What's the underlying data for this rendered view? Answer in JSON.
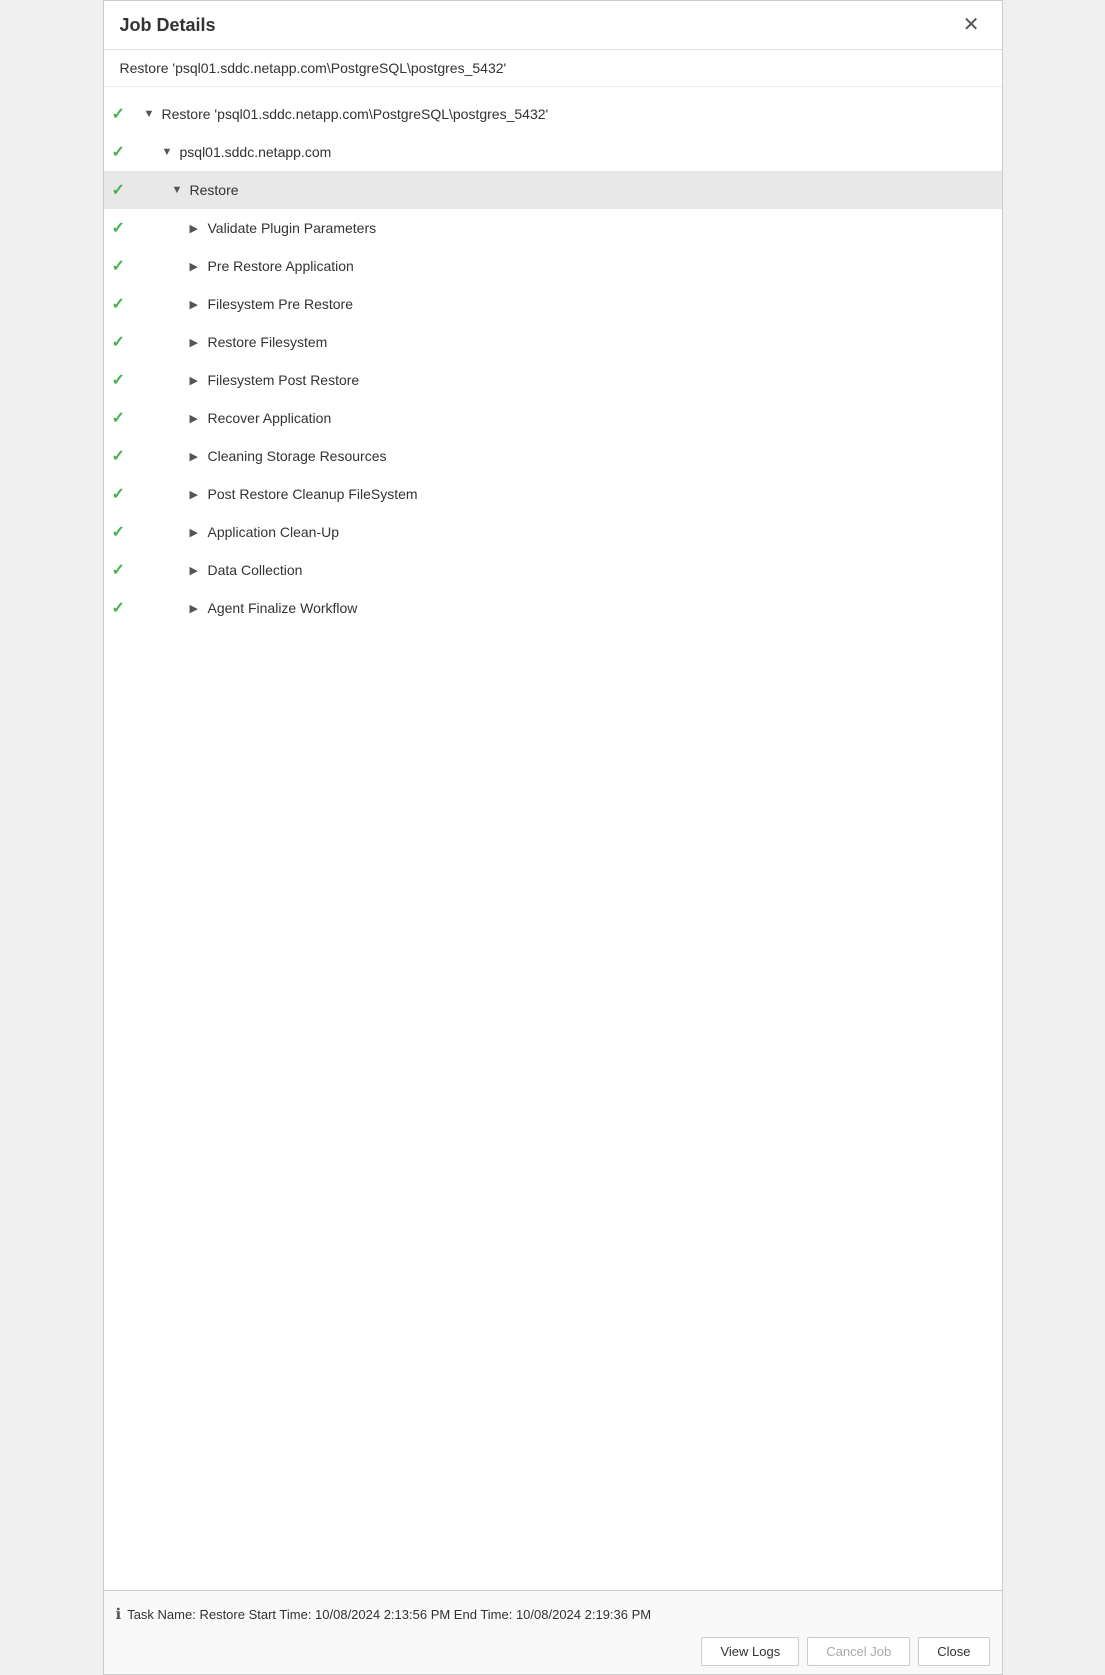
{
  "dialog": {
    "title": "Job Details",
    "close_label": "✕",
    "subtitle": "Restore 'psql01.sddc.netapp.com\\PostgreSQL\\postgres_5432'"
  },
  "tree": {
    "items": [
      {
        "id": "root",
        "indent": 1,
        "check": true,
        "expand": "▼",
        "label": "Restore 'psql01.sddc.netapp.com\\PostgreSQL\\postgres_5432'",
        "highlighted": false
      },
      {
        "id": "host",
        "indent": 2,
        "check": true,
        "expand": "▼",
        "label": "psql01.sddc.netapp.com",
        "highlighted": false
      },
      {
        "id": "restore",
        "indent": 3,
        "check": true,
        "expand": "▼",
        "label": "Restore",
        "highlighted": true
      },
      {
        "id": "validate",
        "indent": 4,
        "check": true,
        "expand": "▶",
        "label": "Validate Plugin Parameters",
        "highlighted": false
      },
      {
        "id": "pre-restore",
        "indent": 4,
        "check": true,
        "expand": "▶",
        "label": "Pre Restore Application",
        "highlighted": false
      },
      {
        "id": "fs-pre-restore",
        "indent": 4,
        "check": true,
        "expand": "▶",
        "label": "Filesystem Pre Restore",
        "highlighted": false
      },
      {
        "id": "restore-fs",
        "indent": 4,
        "check": true,
        "expand": "▶",
        "label": "Restore Filesystem",
        "highlighted": false
      },
      {
        "id": "fs-post-restore",
        "indent": 4,
        "check": true,
        "expand": "▶",
        "label": "Filesystem Post Restore",
        "highlighted": false
      },
      {
        "id": "recover-app",
        "indent": 4,
        "check": true,
        "expand": "▶",
        "label": "Recover Application",
        "highlighted": false
      },
      {
        "id": "clean-storage",
        "indent": 4,
        "check": true,
        "expand": "▶",
        "label": "Cleaning Storage Resources",
        "highlighted": false
      },
      {
        "id": "post-cleanup",
        "indent": 4,
        "check": true,
        "expand": "▶",
        "label": "Post Restore Cleanup FileSystem",
        "highlighted": false
      },
      {
        "id": "app-cleanup",
        "indent": 4,
        "check": true,
        "expand": "▶",
        "label": "Application Clean-Up",
        "highlighted": false
      },
      {
        "id": "data-collection",
        "indent": 4,
        "check": true,
        "expand": "▶",
        "label": "Data Collection",
        "highlighted": false
      },
      {
        "id": "agent-finalize",
        "indent": 4,
        "check": true,
        "expand": "▶",
        "label": "Agent Finalize Workflow",
        "highlighted": false
      }
    ]
  },
  "footer": {
    "info_text": "Task Name: Restore Start Time: 10/08/2024 2:13:56 PM End Time: 10/08/2024 2:19:36 PM",
    "buttons": {
      "view_logs": "View Logs",
      "cancel_job": "Cancel Job",
      "close": "Close"
    }
  }
}
